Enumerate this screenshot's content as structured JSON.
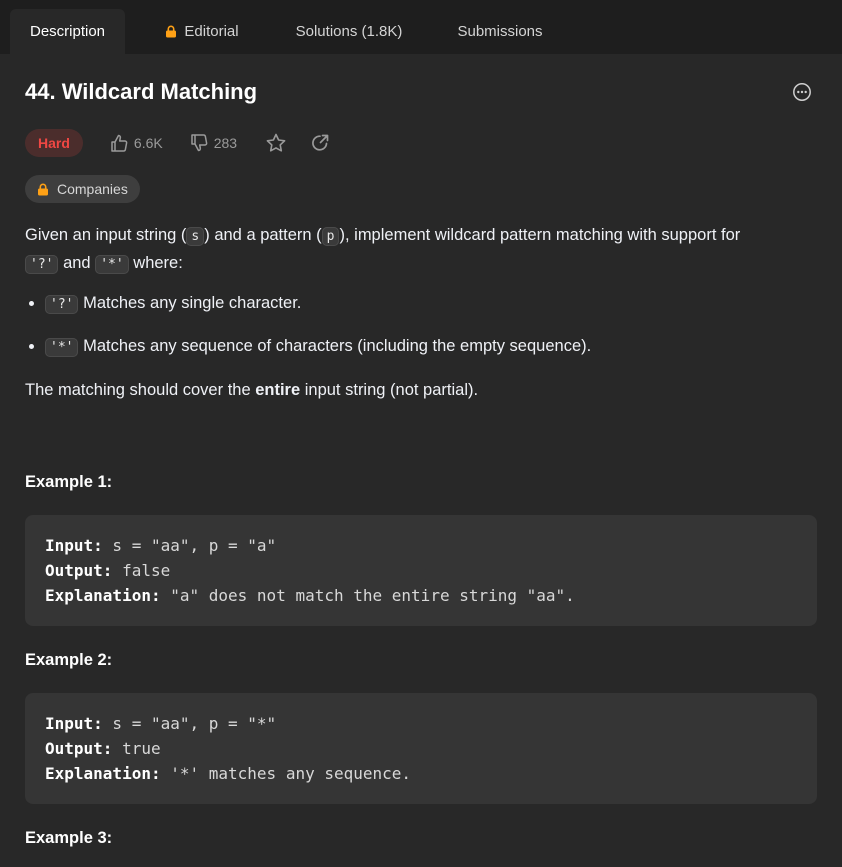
{
  "tabs": [
    {
      "label": "Description",
      "active": true
    },
    {
      "label": "Editorial",
      "locked": true
    },
    {
      "label": "Solutions (1.8K)"
    },
    {
      "label": "Submissions"
    }
  ],
  "problem": {
    "title": "44. Wildcard Matching",
    "difficulty": "Hard",
    "likes": "6.6K",
    "dislikes": "283",
    "companies_label": "Companies"
  },
  "description": {
    "intro_1": "Given an input string (",
    "code_s": "s",
    "intro_2": ") and a pattern (",
    "code_p": "p",
    "intro_3": "), implement wildcard pattern matching with support for",
    "code_q": "'?'",
    "and": "and",
    "code_star": "'*'",
    "where": "where:",
    "bullets": [
      {
        "code": "'?'",
        "text": "Matches any single character."
      },
      {
        "code": "'*'",
        "text": "Matches any sequence of characters (including the empty sequence)."
      }
    ],
    "note_1": "The matching should cover the ",
    "note_bold": "entire",
    "note_2": " input string (not partial)."
  },
  "examples": [
    {
      "title": "Example 1:",
      "input_label": "Input:",
      "input": " s = \"aa\", p = \"a\"",
      "output_label": "Output:",
      "output": " false",
      "explanation_label": "Explanation:",
      "explanation": " \"a\" does not match the entire string \"aa\"."
    },
    {
      "title": "Example 2:",
      "input_label": "Input:",
      "input": " s = \"aa\", p = \"*\"",
      "output_label": "Output:",
      "output": " true",
      "explanation_label": "Explanation:",
      "explanation": " '*' matches any sequence."
    },
    {
      "title": "Example 3:"
    }
  ],
  "colors": {
    "background": "#282828",
    "tabbar": "#1e1e1e",
    "hard": "#ef4743",
    "lock": "#ffa116",
    "code_block": "#353535"
  }
}
